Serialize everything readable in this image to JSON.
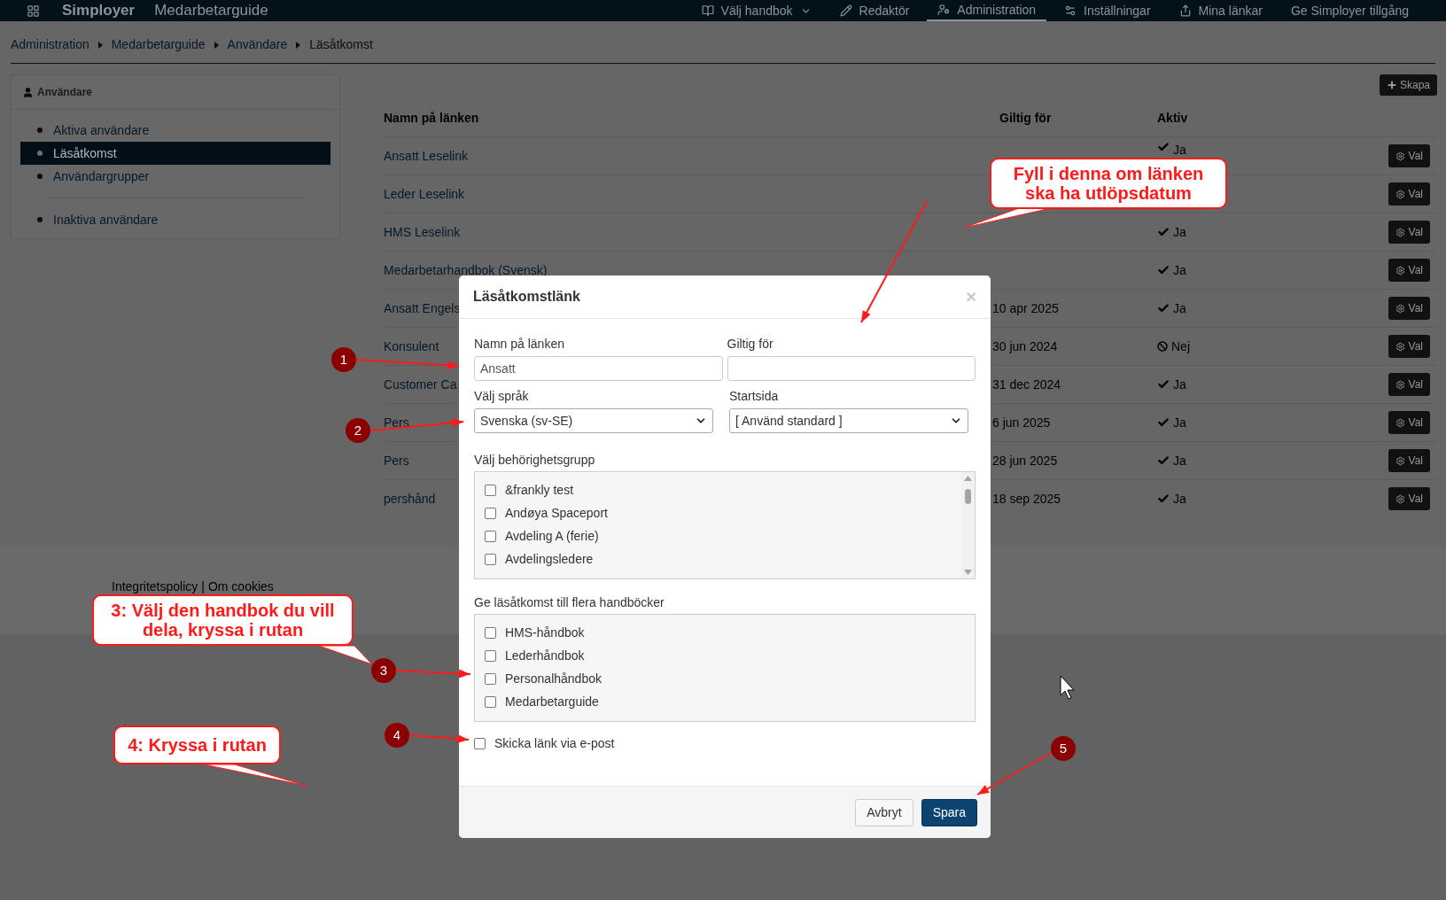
{
  "top_bar": {
    "logo": "Simployer",
    "product": "Medarbetarguide",
    "nav": [
      {
        "label": "Välj handbok",
        "kind": "dropdown",
        "selected": false
      },
      {
        "label": "Redaktör",
        "kind": "link",
        "selected": false
      },
      {
        "label": "Administration",
        "kind": "link",
        "selected": true
      },
      {
        "label": "Inställningar",
        "kind": "link",
        "selected": false
      },
      {
        "label": "Mina länkar",
        "kind": "link",
        "selected": false
      },
      {
        "label": "Ge Simployer tillgång",
        "kind": "plain",
        "selected": false
      }
    ]
  },
  "breadcrumb": [
    {
      "label": "Administration",
      "kind": "link"
    },
    {
      "label": "Medarbetarguide",
      "kind": "link"
    },
    {
      "label": "Användare",
      "kind": "link"
    },
    {
      "label": "Läsåtkomst",
      "kind": "current"
    }
  ],
  "sidebar": {
    "title": "Användare",
    "groups": [
      {
        "items": [
          {
            "label": "Aktiva användare",
            "selected": false
          },
          {
            "label": "Läsåtkomst",
            "selected": true
          },
          {
            "label": "Användargrupper",
            "selected": false
          }
        ]
      },
      {
        "items": [
          {
            "label": "Inaktiva användare",
            "selected": false
          }
        ]
      }
    ]
  },
  "table": {
    "create_button": "Skapa",
    "columns": [
      "Namn på länken",
      "Giltig för",
      "Aktiv"
    ],
    "rows": [
      {
        "name": "Ansatt Leselink",
        "active": true,
        "active_label": "Ja",
        "action": "Val"
      },
      {
        "name": "Leder Leselink",
        "action": "Val"
      },
      {
        "name": "HMS Leselink",
        "active": true,
        "active_label": "Ja",
        "action": "Val"
      },
      {
        "name": "Medarbetarhandbok (Svensk)",
        "active": true,
        "active_label": "Ja",
        "action": "Val"
      },
      {
        "name": "Ansatt Engels",
        "valid_for": "10 apr 2025",
        "active": true,
        "active_label": "Ja",
        "action": "Val"
      },
      {
        "name": "Konsulent",
        "valid_for": "30 jun 2024",
        "active": false,
        "active_label": "Nej",
        "action": "Val"
      },
      {
        "name": "Customer Ca",
        "valid_for": "31 dec 2024",
        "active": true,
        "active_label": "Ja",
        "action": "Val"
      },
      {
        "name": "Pers",
        "valid_for": "6 jun 2025",
        "active": true,
        "active_label": "Ja",
        "action": "Val"
      },
      {
        "name": "Pers",
        "valid_for": "28 jun 2025",
        "active": true,
        "active_label": "Ja",
        "action": "Val"
      },
      {
        "name": "pershånd",
        "valid_for": "18 sep 2025",
        "active": true,
        "active_label": "Ja",
        "action": "Val"
      }
    ]
  },
  "footer": {
    "links": [
      "Integritetspolicy",
      "Om cookies"
    ],
    "separator": "|"
  },
  "modal": {
    "title": "Läsåtkomstlänk",
    "close": "×",
    "name_field": {
      "label": "Namn på länken",
      "value": "Ansatt"
    },
    "valid_field": {
      "label": "Giltig för"
    },
    "language_select": {
      "label": "Välj språk",
      "value": "Svenska (sv-SE)"
    },
    "start_select": {
      "label": "Startsida",
      "value": "[ Använd standard ]"
    },
    "groups": {
      "label": "Välj behörighetsgrupp",
      "items": [
        {
          "label": "&frankly test",
          "checked": false
        },
        {
          "label": "Andøya Spaceport",
          "checked": false
        },
        {
          "label": "Avdeling A (ferie)",
          "checked": false
        },
        {
          "label": "Avdelingsledere",
          "checked": false
        }
      ]
    },
    "books": {
      "label": "Ge läsåtkomst till flera handböcker",
      "items": [
        {
          "label": "HMS-håndbok",
          "checked": false
        },
        {
          "label": "Lederhåndbok",
          "checked": false
        },
        {
          "label": "Personalhåndbok",
          "checked": false
        },
        {
          "label": "Medarbetarguide",
          "checked": false
        }
      ]
    },
    "email": {
      "label": "Skicka länk via e-post",
      "checked": false
    },
    "buttons": [
      {
        "label": "Avbryt",
        "kind": "default"
      },
      {
        "label": "Spara",
        "kind": "primary"
      }
    ]
  },
  "annotations": {
    "callouts": [
      {
        "text": "Fyll i denna om länken ska ha utlöpsdatum"
      },
      {
        "text": "3: Välj den handbok du vill dela, kryssa i rutan"
      },
      {
        "text": "4: Kryssa i rutan"
      }
    ],
    "markers": [
      {
        "number": "1"
      },
      {
        "number": "2"
      },
      {
        "number": "3"
      },
      {
        "number": "4"
      },
      {
        "number": "5"
      }
    ]
  }
}
